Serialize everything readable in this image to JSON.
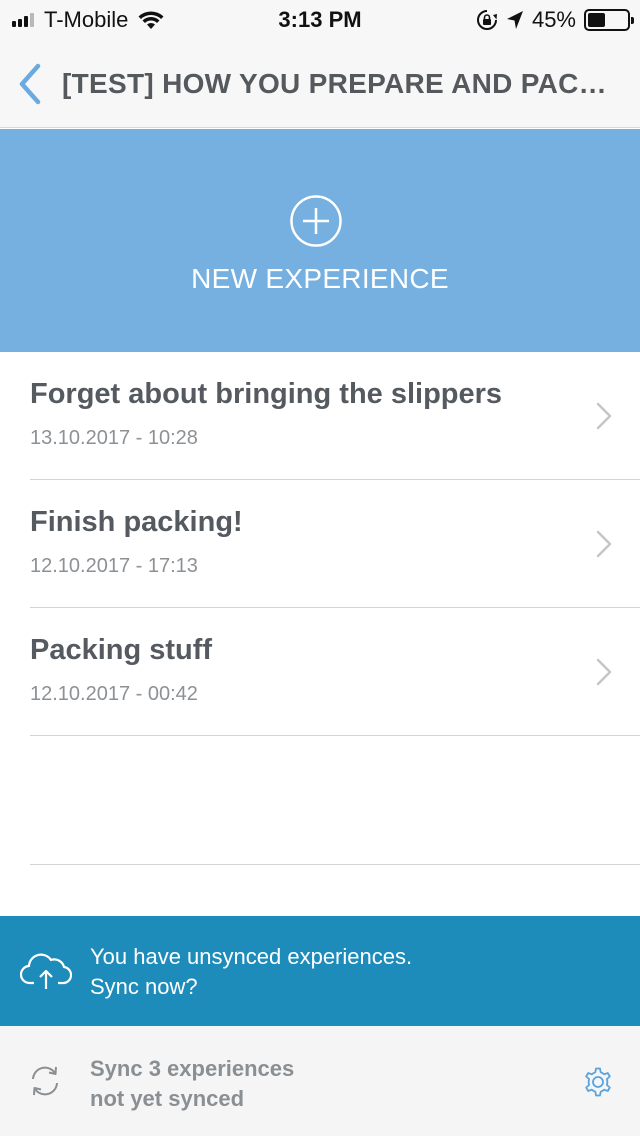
{
  "status_bar": {
    "carrier": "T-Mobile",
    "time": "3:13 PM",
    "battery_percent": "45%",
    "battery_level": 0.45,
    "icons": [
      "signal-icon",
      "wifi-icon",
      "orientation-lock-icon",
      "location-arrow-icon",
      "battery-icon"
    ]
  },
  "nav": {
    "back_icon": "chevron-left-icon",
    "title": "[TEST] HOW YOU PREPARE AND PACK..."
  },
  "new_experience": {
    "icon": "plus-circle-icon",
    "label": "NEW EXPERIENCE"
  },
  "experiences": [
    {
      "title": "Forget about bringing the slippers",
      "date": "13.10.2017 - 10:28"
    },
    {
      "title": "Finish packing!",
      "date": "12.10.2017 - 17:13"
    },
    {
      "title": "Packing stuff",
      "date": "12.10.2017 - 00:42"
    }
  ],
  "unsynced_banner": {
    "icon": "cloud-upload-icon",
    "line1": "You have unsynced experiences.",
    "line2": "Sync now?"
  },
  "footer": {
    "sync_icon": "sync-icon",
    "line1": "Sync 3 experiences",
    "line2": "not yet synced",
    "settings_icon": "gear-icon"
  },
  "colors": {
    "accent_blue": "#75b0e0",
    "sync_banner": "#1e8cba",
    "back_chevron": "#6aaae0",
    "title_text": "#545a60",
    "date_text": "#8d9196"
  }
}
